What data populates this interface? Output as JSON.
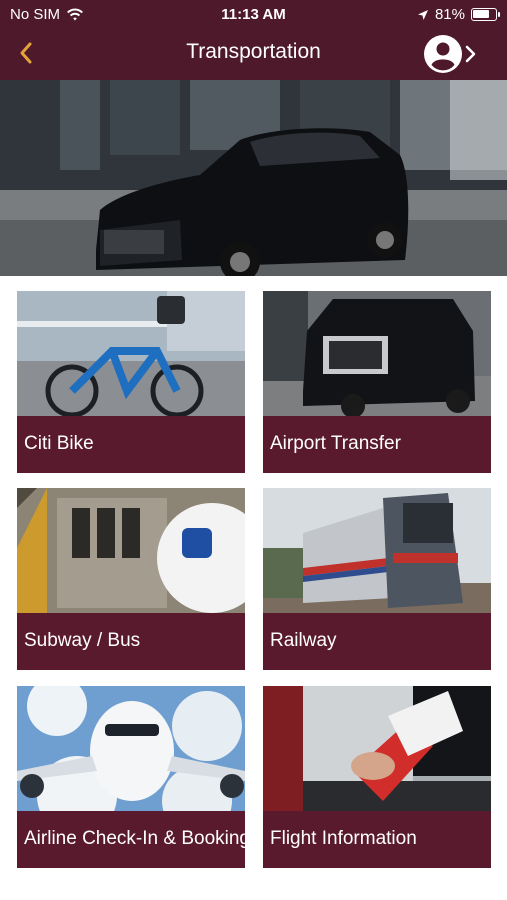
{
  "status_bar": {
    "carrier": "No SIM",
    "time": "11:13 AM",
    "battery_percent": "81%",
    "battery_level": 0.81,
    "icons": [
      "wifi-icon",
      "location-arrow-icon",
      "battery-icon"
    ]
  },
  "nav": {
    "title": "Transportation",
    "back_icon": "chevron-left-icon",
    "profile_icon": "user-circle-icon",
    "accent_color": "#e3a33a",
    "bar_color": "#4e1a2b"
  },
  "hero": {
    "image": "black-sedan-city-street"
  },
  "tiles": [
    {
      "label": "Citi Bike",
      "image": "bike-share-bicycle"
    },
    {
      "label": "Airport Transfer",
      "image": "black-suv"
    },
    {
      "label": "Subway / Bus",
      "image": "subway-train"
    },
    {
      "label": "Railway",
      "image": "amtrak-train"
    },
    {
      "label": "Airline Check-In & Booking",
      "image": "airplane-in-clouds"
    },
    {
      "label": "Flight Information",
      "image": "boarding-pass"
    }
  ],
  "tile_color": "#5a1a2d"
}
